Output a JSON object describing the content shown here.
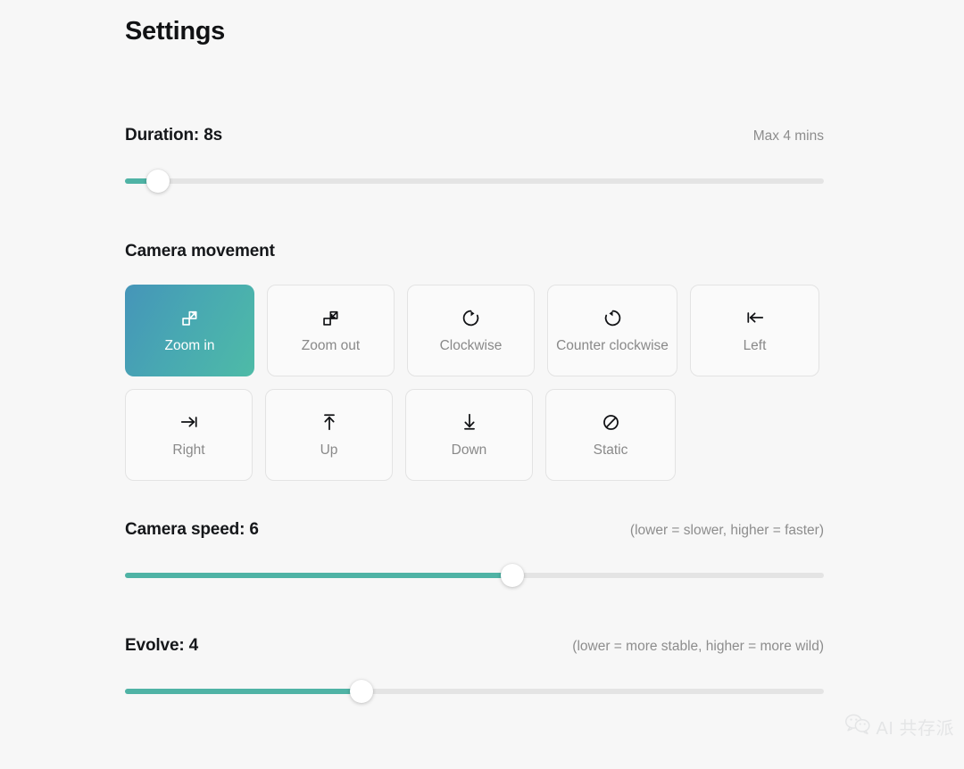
{
  "page": {
    "title": "Settings",
    "background_color": "#f7f7f7",
    "accent_color": "#4fb3a5",
    "selected_gradient_from": "#4595b9",
    "selected_gradient_to": "#4ebba7"
  },
  "duration": {
    "label": "Duration: 8s",
    "hint": "Max 4 mins",
    "value": 8,
    "unit": "s",
    "min": 1,
    "max": 240,
    "fill_percent": 4.7
  },
  "camera_movement": {
    "heading": "Camera movement",
    "selected": "Zoom in",
    "options": [
      {
        "label": "Zoom in",
        "icon": "zoom-in-icon",
        "selected": true
      },
      {
        "label": "Zoom out",
        "icon": "zoom-out-icon",
        "selected": false
      },
      {
        "label": "Clockwise",
        "icon": "rotate-clockwise-icon",
        "selected": false
      },
      {
        "label": "Counter clockwise",
        "icon": "rotate-counter-clockwise-icon",
        "selected": false
      },
      {
        "label": "Left",
        "icon": "arrow-bar-left-icon",
        "selected": false
      },
      {
        "label": "Right",
        "icon": "arrow-bar-right-icon",
        "selected": false
      },
      {
        "label": "Up",
        "icon": "arrow-bar-up-icon",
        "selected": false
      },
      {
        "label": "Down",
        "icon": "arrow-bar-down-icon",
        "selected": false
      },
      {
        "label": "Static",
        "icon": "ban-icon",
        "selected": false
      }
    ]
  },
  "camera_speed": {
    "label": "Camera speed: 6",
    "hint": "(lower = slower, higher = faster)",
    "value": 6,
    "min": 1,
    "max": 10,
    "fill_percent": 55.4
  },
  "evolve": {
    "label": "Evolve: 4",
    "hint": "(lower = more stable, higher = more wild)",
    "value": 4,
    "min": 1,
    "max": 10,
    "fill_percent": 33.9
  },
  "watermark": {
    "text": "AI 共存派",
    "icon": "wechat-icon"
  }
}
